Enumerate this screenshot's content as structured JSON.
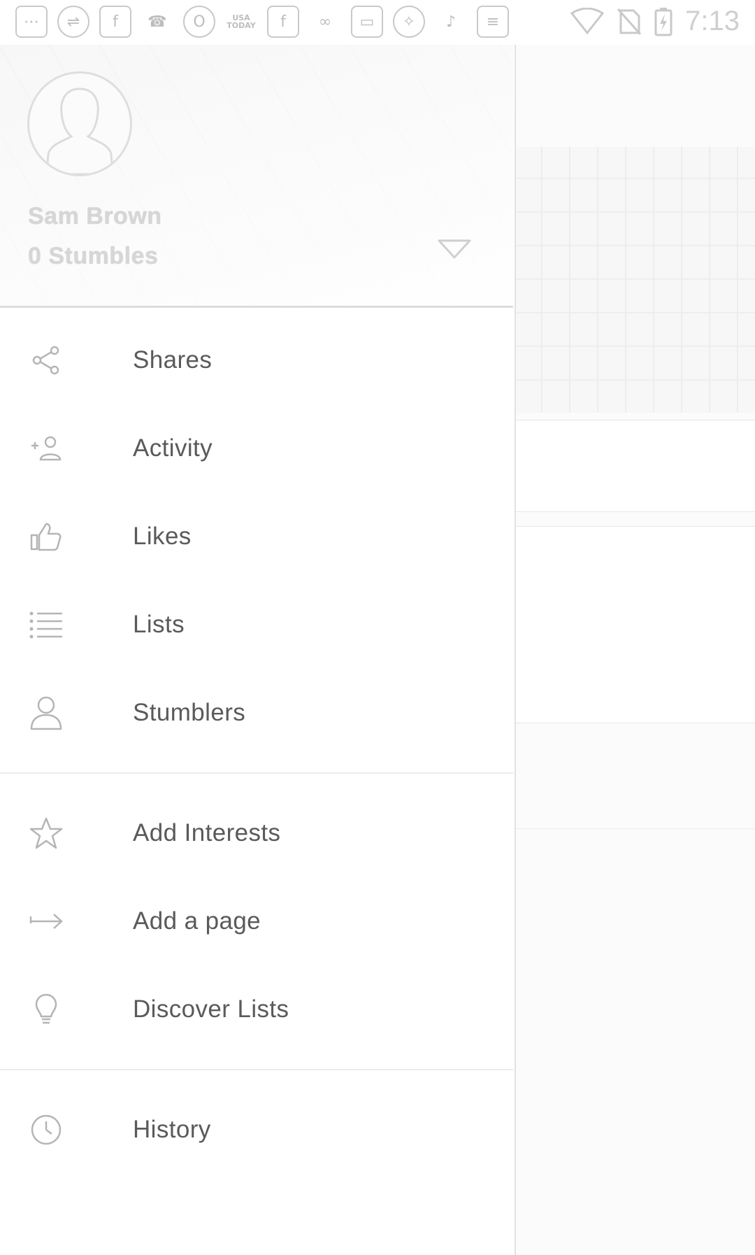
{
  "status_bar": {
    "notification_icons": [
      "more-icon",
      "usb-icon",
      "facebook-icon",
      "phone-icon",
      "opera-icon",
      "usa-today-icon",
      "facebook-icon",
      "link-icon",
      "cassette-icon",
      "fitness-icon",
      "violin-icon",
      "sliders-icon"
    ],
    "usa_today_text": "USA TODAY",
    "time": "7:13"
  },
  "drawer": {
    "user": {
      "name": "Sam Brown",
      "stumbles": "0 Stumbles"
    },
    "menu_group_1": [
      {
        "label": "Shares",
        "icon": "share-icon"
      },
      {
        "label": "Activity",
        "icon": "add-person-icon"
      },
      {
        "label": "Likes",
        "icon": "thumbs-up-icon"
      },
      {
        "label": "Lists",
        "icon": "list-icon"
      },
      {
        "label": "Stumblers",
        "icon": "person-icon"
      }
    ],
    "menu_group_2": [
      {
        "label": "Add Interests",
        "icon": "star-icon"
      },
      {
        "label": "Add a page",
        "icon": "arrow-right-icon"
      },
      {
        "label": "Discover Lists",
        "icon": "lightbulb-icon"
      }
    ],
    "menu_group_3": [
      {
        "label": "History",
        "icon": "clock-icon"
      }
    ]
  },
  "colors": {
    "icon": "#b5b5b5",
    "text": "#5a5a5a",
    "divider": "#ececec"
  }
}
